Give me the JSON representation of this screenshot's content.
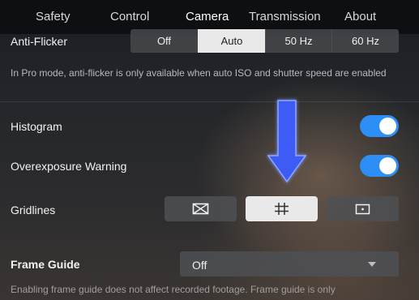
{
  "nav": {
    "tabs": [
      {
        "label": "Safety"
      },
      {
        "label": "Control"
      },
      {
        "label": "Camera"
      },
      {
        "label": "Transmission"
      },
      {
        "label": "About"
      }
    ],
    "active": "Camera"
  },
  "anti_flicker": {
    "label": "Anti-Flicker",
    "options": [
      "Off",
      "Auto",
      "50 Hz",
      "60 Hz"
    ],
    "selected": "Auto",
    "info": "In Pro mode, anti-flicker is only available when auto ISO and shutter speed are enabled"
  },
  "histogram": {
    "label": "Histogram",
    "enabled": true
  },
  "overexposure": {
    "label": "Overexposure Warning",
    "enabled": true
  },
  "gridlines": {
    "label": "Gridlines",
    "options": [
      {
        "icon": "diagonal-grid-icon"
      },
      {
        "icon": "grid-icon"
      },
      {
        "icon": "center-point-icon"
      }
    ],
    "selected_index": 1
  },
  "frame_guide": {
    "label": "Frame Guide",
    "value": "Off",
    "footnote": "Enabling frame guide does not affect recorded footage. Frame guide is only"
  },
  "annotation": {
    "arrow_color": "#3d5bf5"
  },
  "colors": {
    "toggle_on": "#2d8ef5",
    "selected_segment": "#e9e9ea"
  }
}
